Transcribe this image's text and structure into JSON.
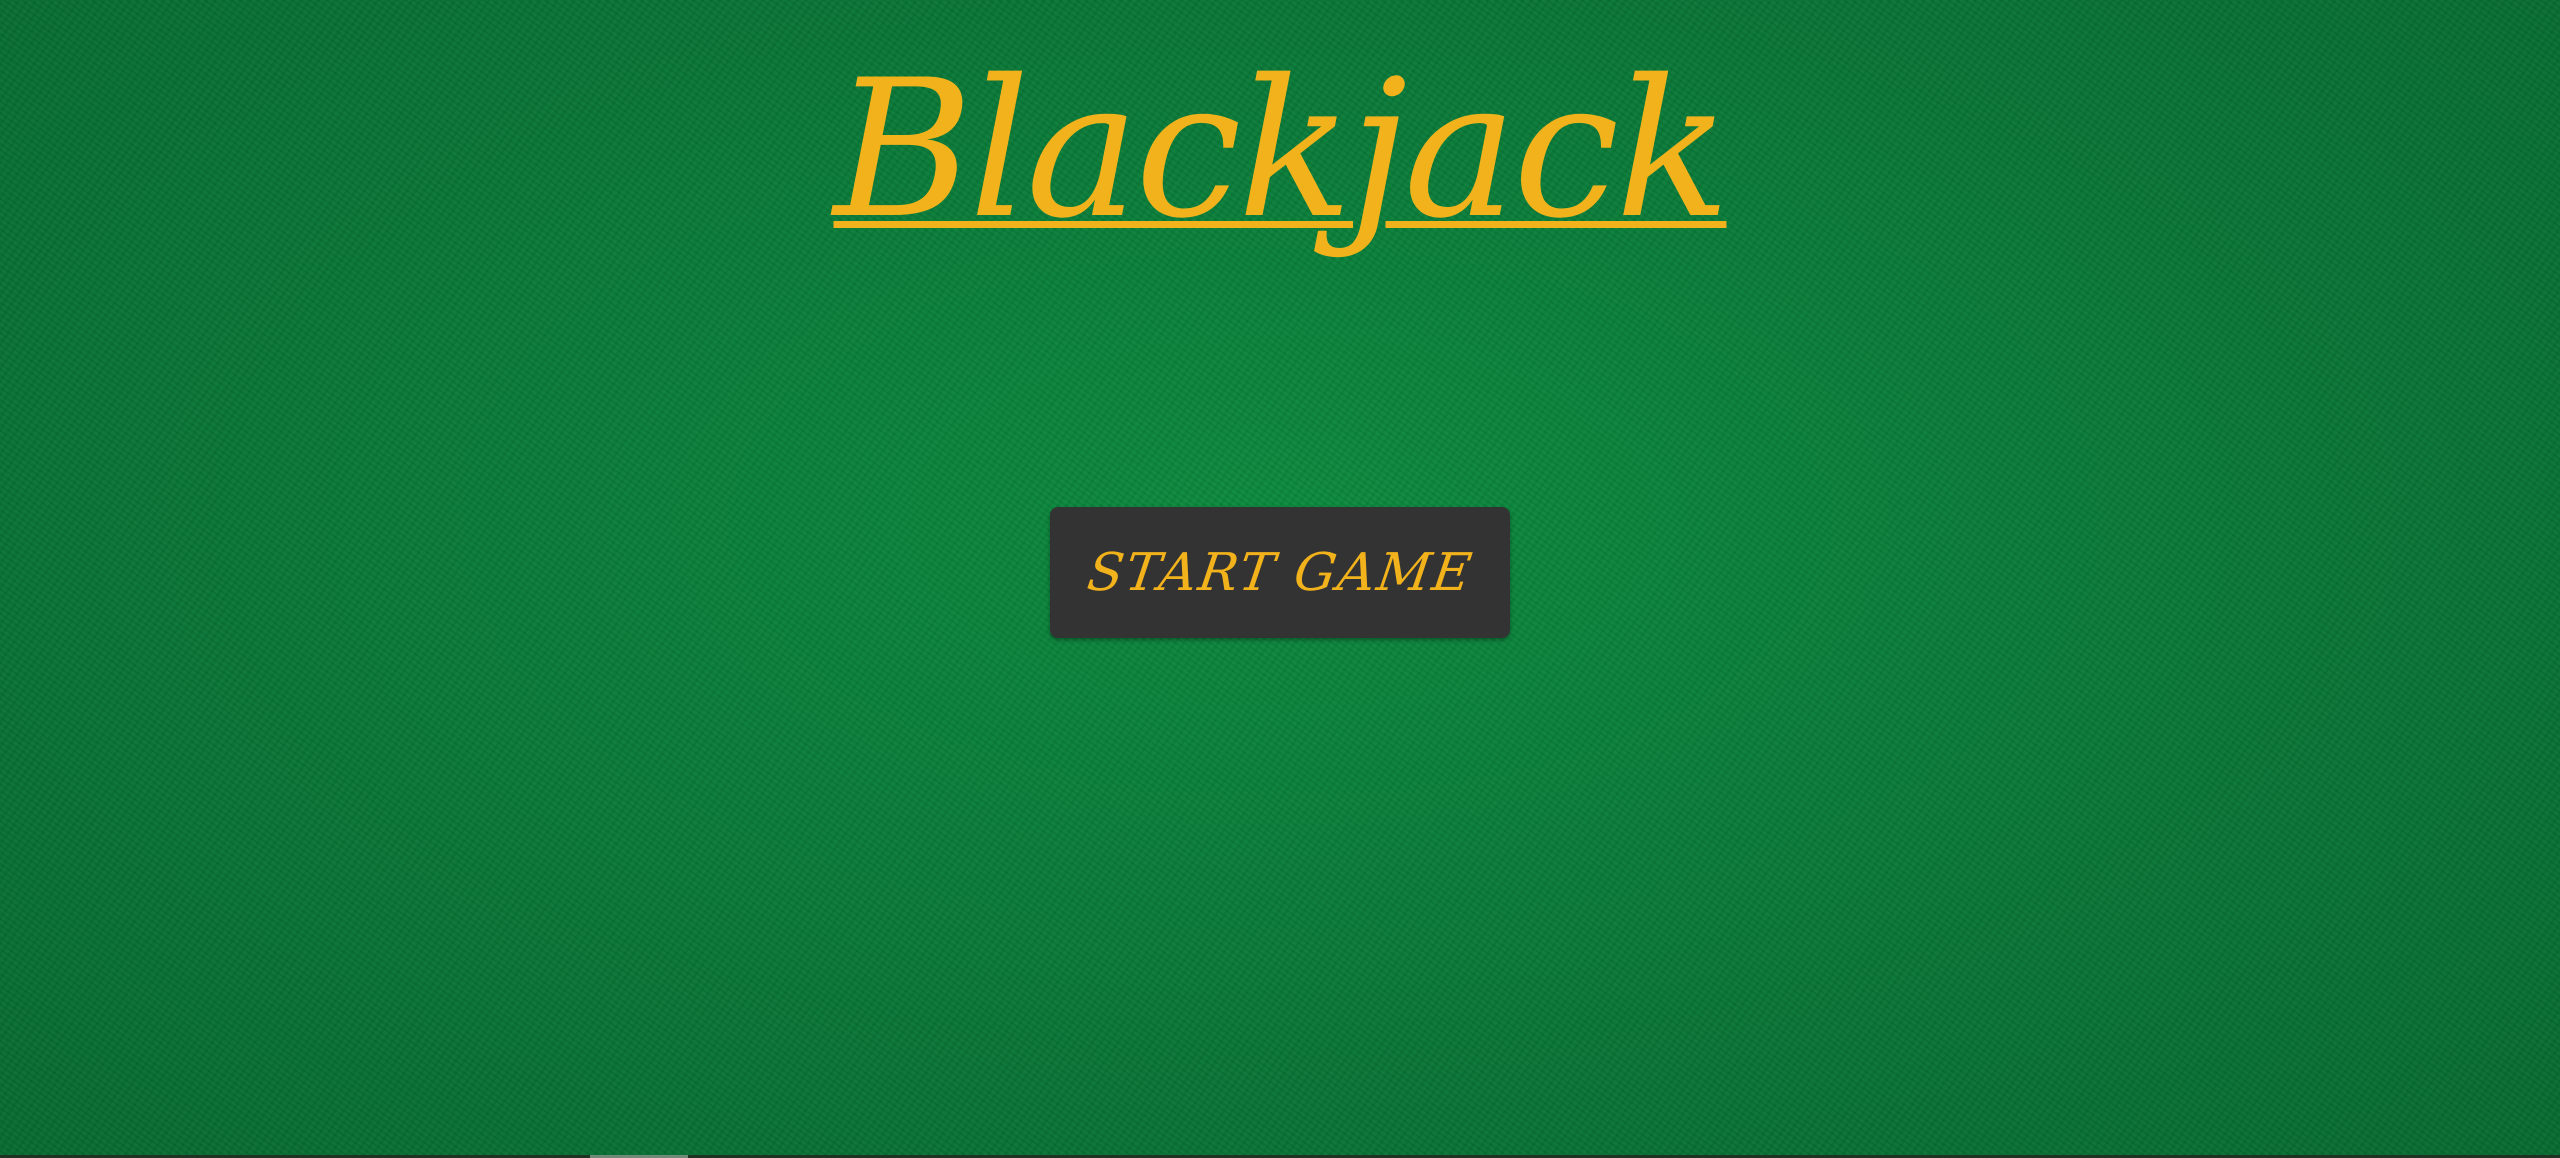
{
  "game": {
    "title": "Blackjack",
    "start_button_label": "START GAME"
  },
  "colors": {
    "felt": "#0a7a37",
    "gold": "#f2b21b",
    "button_bg": "#333333"
  }
}
